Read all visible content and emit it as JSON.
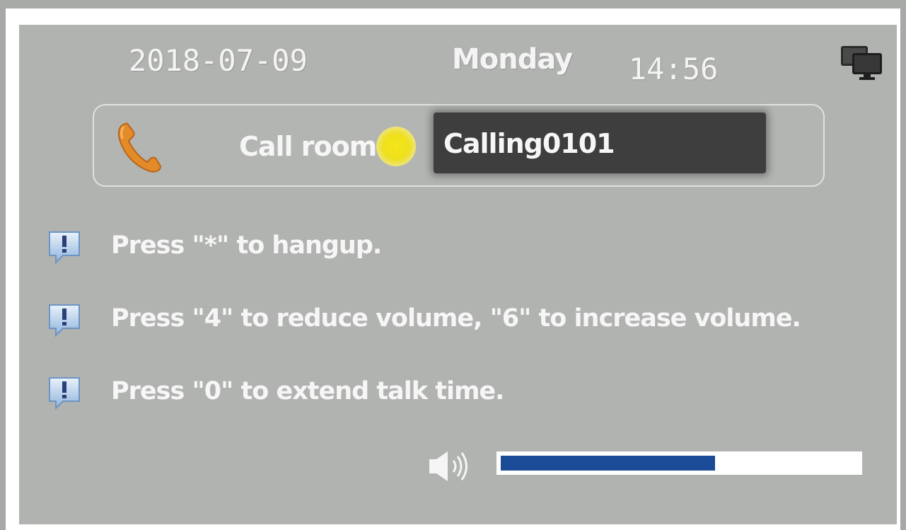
{
  "header": {
    "date": "2018-07-09",
    "day": "Monday",
    "time": "14:56"
  },
  "icons": {
    "monitor": "monitor-icon",
    "phone": "phone-handset-icon",
    "status": "status-indicator-icon",
    "hint": "exclamation-bubble-icon",
    "speaker": "speaker-icon"
  },
  "call": {
    "label": "Call room",
    "status_text": "Calling0101",
    "status_color": "#f2e41c"
  },
  "hints": [
    {
      "text": "Press \"*\" to hangup."
    },
    {
      "text": "Press \"4\" to reduce volume, \"6\" to increase volume."
    },
    {
      "text": "Press \"0\" to extend talk time."
    }
  ],
  "volume": {
    "level": 0.6,
    "fill_color": "#1b4a96"
  }
}
